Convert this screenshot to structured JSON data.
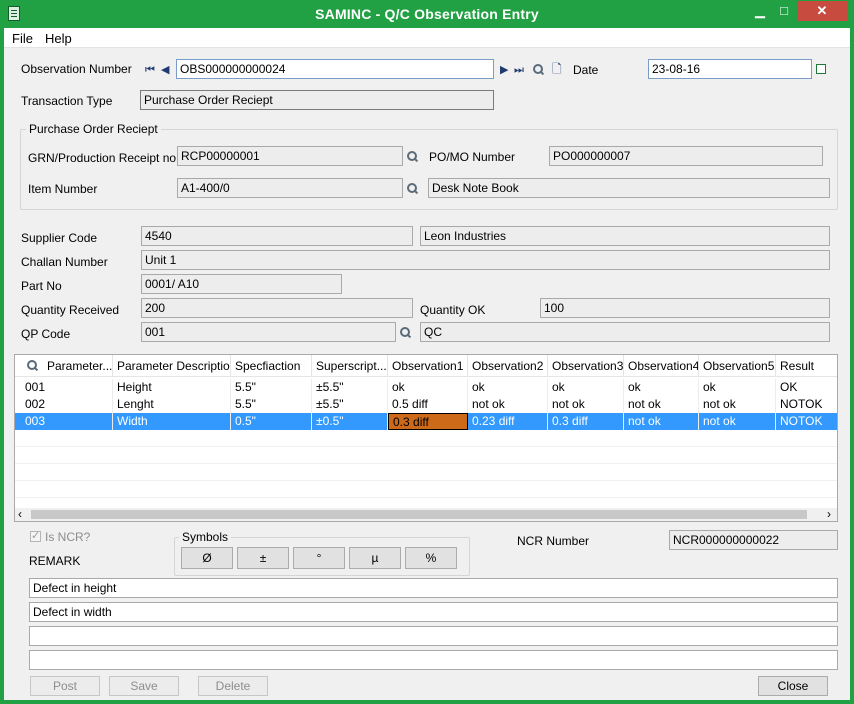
{
  "window": {
    "title": "SAMINC - Q/C Observation Entry",
    "minimize": "▁",
    "maximize": "□",
    "close": "✕"
  },
  "menu": [
    "File",
    "Help"
  ],
  "form": {
    "observation_number_label": "Observation Number",
    "observation_number": "OBS000000000024",
    "date_label": "Date",
    "date": "23-08-16",
    "transaction_type_label": "Transaction Type",
    "transaction_type": "Purchase Order Reciept",
    "group_title": "Purchase Order Reciept",
    "grn_label": "GRN/Production Receipt no",
    "grn": "RCP00000001",
    "po_label": "PO/MO Number",
    "po": "PO000000007",
    "item_label": "Item Number",
    "item": "A1-400/0",
    "item_desc": "Desk Note Book",
    "supplier_label": "Supplier Code",
    "supplier_code": "4540",
    "supplier_name": "Leon Industries",
    "challan_label": "Challan Number",
    "challan": "Unit 1",
    "part_label": "Part No",
    "part": "0001/ A10",
    "qty_received_label": "Quantity Received",
    "qty_received": "200",
    "qty_ok_label": "Quantity OK",
    "qty_ok": "100",
    "qp_label": "QP Code",
    "qp_code": "001",
    "qp_desc": "QC"
  },
  "grid": {
    "columns": [
      "Parameter...",
      "Parameter Description",
      "Specfiaction",
      "Superscript...",
      "Observation1",
      "Observation2",
      "Observation3",
      "Observation4",
      "Observation5",
      "Result"
    ],
    "rows": [
      [
        "001",
        "Height",
        "5.5\"",
        "±5.5\"",
        "ok",
        "ok",
        "ok",
        "ok",
        "ok",
        "OK"
      ],
      [
        "002",
        "Lenght",
        "5.5\"",
        "±5.5\"",
        "0.5 diff",
        "not ok",
        "not ok",
        "not ok",
        "not ok",
        "NOTOK"
      ],
      [
        "003",
        "Width",
        "0.5\"",
        "±0.5\"",
        "0.3 diff",
        "0.23 diff",
        "0.3 diff",
        "not ok",
        "not ok",
        "NOTOK"
      ]
    ],
    "selected_row": 2,
    "scroll_left": "‹",
    "scroll_right": "›"
  },
  "ncr": {
    "is_ncr_label": "Is NCR?",
    "is_ncr_checked": true,
    "remark_label": "REMARK",
    "symbols_title": "Symbols",
    "symbols": [
      "Ø",
      "±",
      "°",
      "µ",
      "%"
    ],
    "ncr_number_label": "NCR Number",
    "ncr_number": "NCR000000000022",
    "remarks": [
      "Defect in height",
      "Defect in width",
      "",
      ""
    ]
  },
  "buttons": {
    "post": "Post",
    "save": "Save",
    "delete": "Delete",
    "close": "Close"
  },
  "colors": {
    "title_bar": "#21a143",
    "selection": "#3399ff",
    "active_cell": "#cc6a1a",
    "close_button": "#c74b3f"
  }
}
